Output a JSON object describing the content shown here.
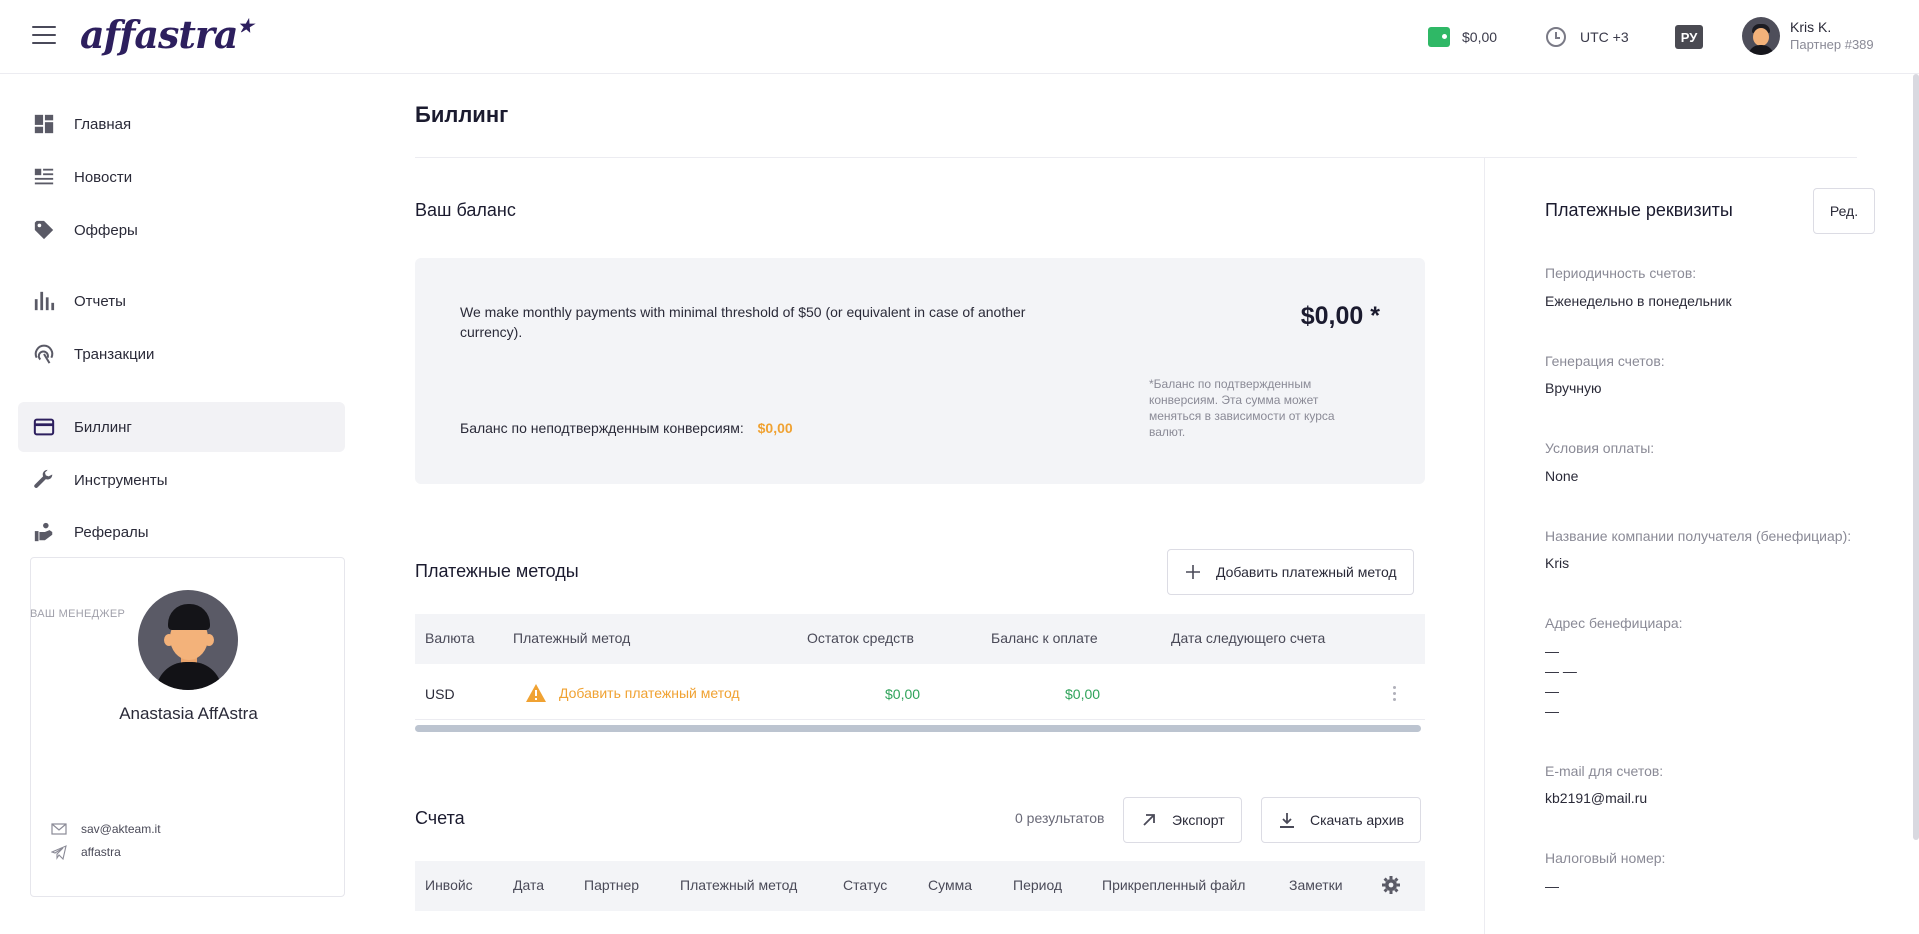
{
  "header": {
    "logo": "affastra",
    "logo_star": "★",
    "balance": "$0,00",
    "timezone": "UTC +3",
    "lang": "РУ",
    "user_name": "Kris K.",
    "user_sub": "Партнер #389"
  },
  "sidebar": {
    "items": [
      {
        "label": "Главная",
        "icon": "dashboard-icon"
      },
      {
        "label": "Новости",
        "icon": "news-icon"
      },
      {
        "label": "Офферы",
        "icon": "tag-icon"
      },
      {
        "label": "Отчеты",
        "icon": "bar-chart-icon"
      },
      {
        "label": "Транзакции",
        "icon": "fingerprint-icon"
      },
      {
        "label": "Биллинг",
        "icon": "credit-card-icon"
      },
      {
        "label": "Инструменты",
        "icon": "wrench-icon"
      },
      {
        "label": "Рефералы",
        "icon": "referral-icon"
      }
    ],
    "active": "Биллинг",
    "manager_label": "ВАШ МЕНЕДЖЕР",
    "manager_name": "Anastasia AffAstra",
    "manager_email": "sav@akteam.it",
    "manager_telegram": "affastra"
  },
  "main": {
    "title": "Биллинг",
    "balance_section": {
      "title": "Ваш баланс",
      "info": "We make monthly payments with minimal threshold of $50 (or equivalent in case of another currency).",
      "amount": "$0,00 *",
      "note": "*Баланс по подтвержденным конверсиям. Эта сумма может меняться в зависимости от курса валют.",
      "unconfirmed_label": "Баланс по неподтвержденным конверсиям:",
      "unconfirmed_value": "$0,00"
    },
    "payment_methods": {
      "title": "Платежные методы",
      "add_button": "Добавить платежный метод",
      "columns": [
        "Валюта",
        "Платежный метод",
        "Остаток средств",
        "Баланс к оплате",
        "Дата следующего счета"
      ],
      "rows": [
        {
          "currency": "USD",
          "method": "Добавить платежный метод",
          "remaining": "$0,00",
          "to_pay": "$0,00",
          "next_date": ""
        }
      ]
    },
    "invoices": {
      "title": "Счета",
      "results": "0 результатов",
      "export_button": "Экспорт",
      "download_button": "Скачать архив",
      "columns": [
        "Инвойс",
        "Дата",
        "Партнер",
        "Платежный метод",
        "Статус",
        "Сумма",
        "Период",
        "Прикрепленный файл",
        "Заметки"
      ]
    }
  },
  "requisites": {
    "title": "Платежные реквизиты",
    "edit_button": "Ред.",
    "fields": [
      {
        "label": "Периодичность счетов:",
        "value": "Еженедельно в понедельник"
      },
      {
        "label": "Генерация счетов:",
        "value": "Вручную"
      },
      {
        "label": "Условия оплаты:",
        "value": "None"
      },
      {
        "label": "Название компании получателя (бенефициар):",
        "value": "Kris"
      },
      {
        "label": "Адрес бенефициара:",
        "value": "—\n— —\n—\n—"
      },
      {
        "label": "E-mail для счетов:",
        "value": "kb2191@mail.ru"
      },
      {
        "label": "Налоговый номер:",
        "value": "—"
      }
    ]
  },
  "colors": {
    "accent_orange": "#f0a232",
    "money_green": "#2fa35a",
    "wallet_green": "#2fb866",
    "panel_bg": "#f3f4f7"
  }
}
